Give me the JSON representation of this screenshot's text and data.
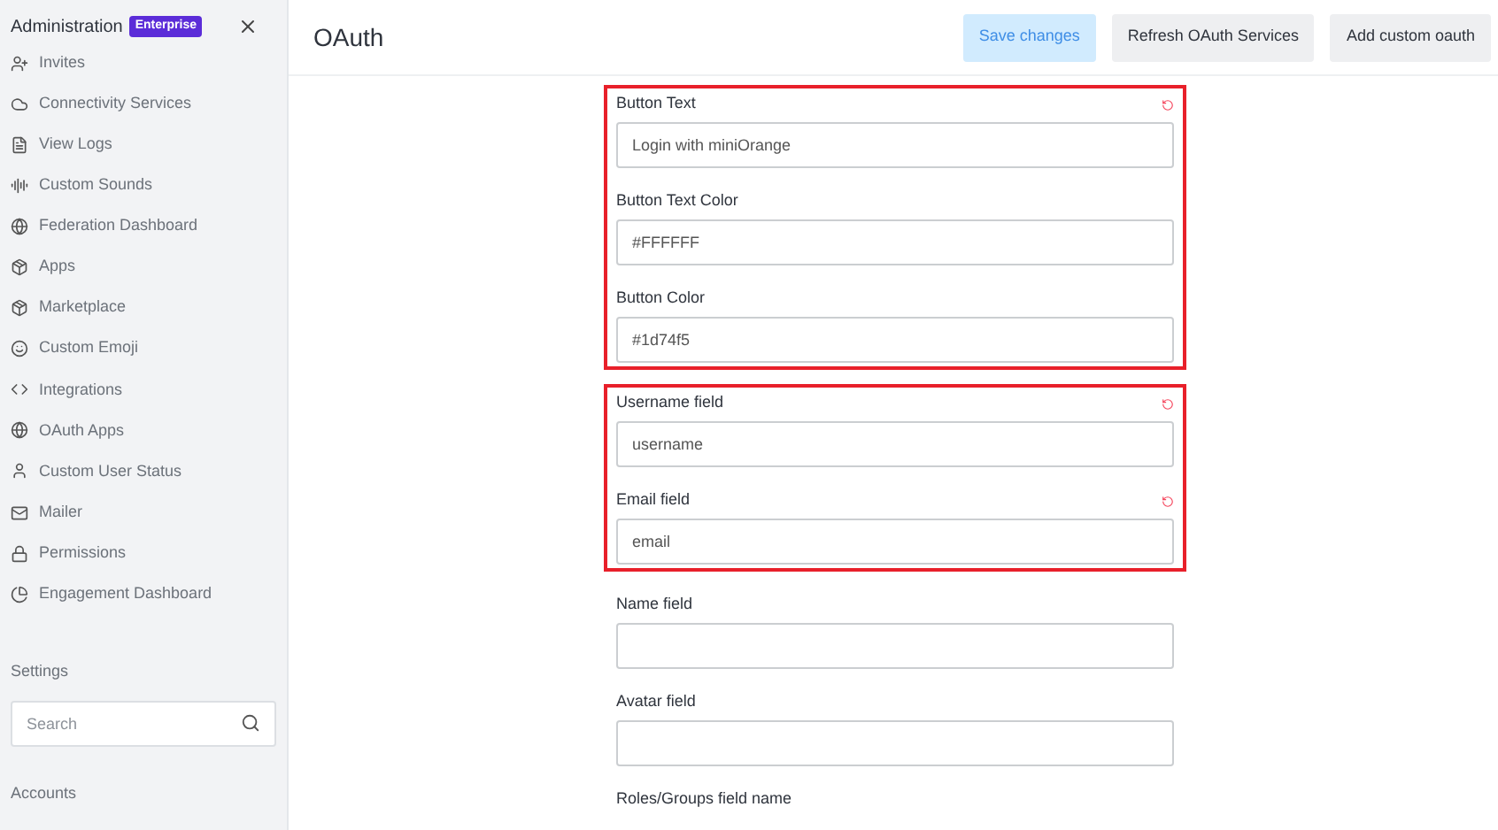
{
  "sidebar": {
    "title": "Administration",
    "badge": "Enterprise",
    "items": [
      {
        "label": "Invites"
      },
      {
        "label": "Connectivity Services"
      },
      {
        "label": "View Logs"
      },
      {
        "label": "Custom Sounds"
      },
      {
        "label": "Federation Dashboard"
      },
      {
        "label": "Apps"
      },
      {
        "label": "Marketplace"
      },
      {
        "label": "Custom Emoji"
      },
      {
        "label": "Integrations"
      },
      {
        "label": "OAuth Apps"
      },
      {
        "label": "Custom User Status"
      },
      {
        "label": "Mailer"
      },
      {
        "label": "Permissions"
      },
      {
        "label": "Engagement Dashboard"
      }
    ],
    "settings_label": "Settings",
    "search": {
      "placeholder": "Search"
    },
    "section": "Accounts"
  },
  "header": {
    "title": "OAuth",
    "buttons": [
      {
        "label": "Save changes",
        "disabled": true
      },
      {
        "label": "Refresh OAuth Services",
        "disabled": false
      },
      {
        "label": "Add custom oauth",
        "disabled": false
      }
    ]
  },
  "groups": [
    {
      "highlighted": true,
      "fields": [
        {
          "label": "Button Text",
          "value": "Login with miniOrange",
          "reset": true
        },
        {
          "label": "Button Text Color",
          "value": "#FFFFFF",
          "reset": false
        },
        {
          "label": "Button Color",
          "value": "#1d74f5",
          "reset": false
        }
      ]
    },
    {
      "highlighted": true,
      "fields": [
        {
          "label": "Username field",
          "value": "username",
          "reset": true
        },
        {
          "label": "Email field",
          "value": "email",
          "reset": true
        }
      ]
    },
    {
      "highlighted": false,
      "fields": [
        {
          "label": "Name field",
          "reset": false
        },
        {
          "label": "Avatar field",
          "reset": false
        }
      ]
    }
  ],
  "cut_label": "Roles/Groups field name"
}
